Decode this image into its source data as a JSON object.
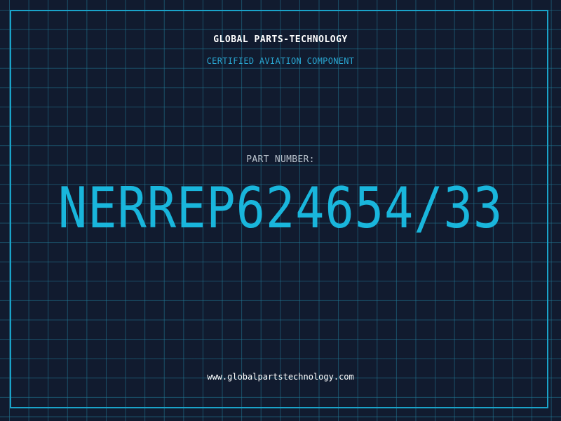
{
  "header": {
    "company": "GLOBAL PARTS-TECHNOLOGY",
    "subtitle": "CERTIFIED AVIATION COMPONENT"
  },
  "part": {
    "label": "PART NUMBER:",
    "number": "NERREP624654/33"
  },
  "footer": {
    "url": "www.globalpartstechnology.com"
  },
  "colors": {
    "background": "#111b2f",
    "grid": "#217a96",
    "accent": "#19b6dc",
    "text": "#ffffff"
  }
}
